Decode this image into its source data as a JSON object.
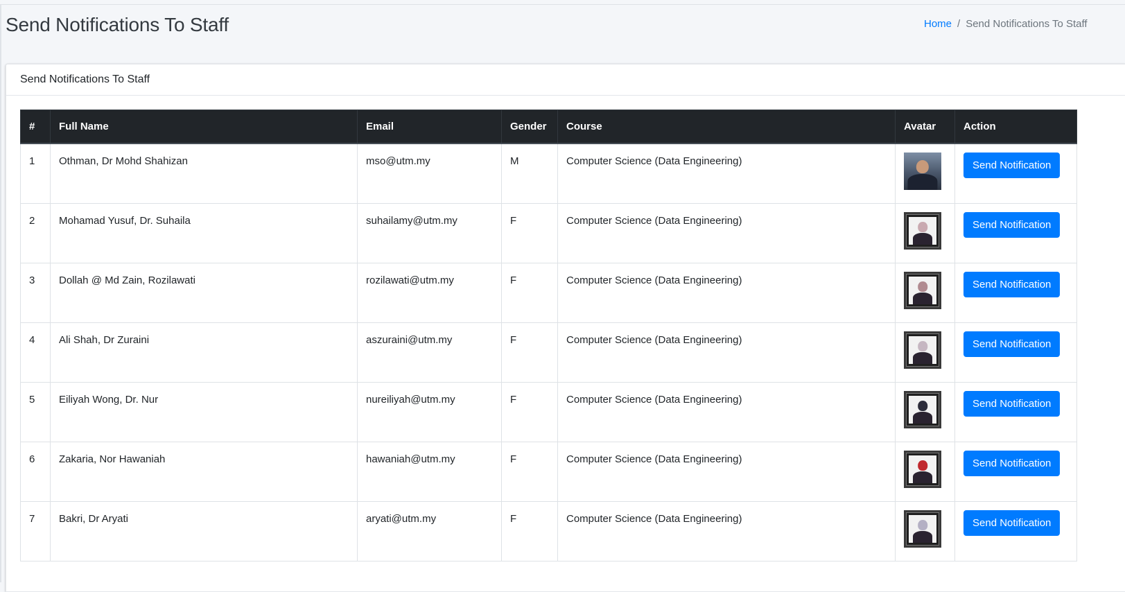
{
  "page": {
    "title": "Send Notifications To Staff"
  },
  "breadcrumb": {
    "home": "Home",
    "separator": "/",
    "current": "Send Notifications To Staff"
  },
  "card": {
    "header": "Send Notifications To Staff"
  },
  "table": {
    "columns": [
      "#",
      "Full Name",
      "Email",
      "Gender",
      "Course",
      "Avatar",
      "Action"
    ],
    "rows": [
      {
        "num": "1",
        "name": "Othman, Dr Mohd Shahizan",
        "email": "mso@utm.my",
        "gender": "M",
        "course": "Computer Science (Data Engineering)",
        "avatar": "photo-portrait",
        "action": "Send Notification"
      },
      {
        "num": "2",
        "name": "Mohamad Yusuf, Dr. Suhaila",
        "email": "suhailamy@utm.my",
        "gender": "F",
        "course": "Computer Science (Data Engineering)",
        "avatar": "framed-portrait",
        "action": "Send Notification"
      },
      {
        "num": "3",
        "name": "Dollah @ Md Zain, Rozilawati",
        "email": "rozilawati@utm.my",
        "gender": "F",
        "course": "Computer Science (Data Engineering)",
        "avatar": "framed-portrait",
        "action": "Send Notification"
      },
      {
        "num": "4",
        "name": "Ali Shah, Dr Zuraini",
        "email": "aszuraini@utm.my",
        "gender": "F",
        "course": "Computer Science (Data Engineering)",
        "avatar": "framed-portrait",
        "action": "Send Notification"
      },
      {
        "num": "5",
        "name": "Eiliyah Wong, Dr. Nur",
        "email": "nureiliyah@utm.my",
        "gender": "F",
        "course": "Computer Science (Data Engineering)",
        "avatar": "framed-portrait",
        "action": "Send Notification"
      },
      {
        "num": "6",
        "name": "Zakaria, Nor Hawaniah",
        "email": "hawaniah@utm.my",
        "gender": "F",
        "course": "Computer Science (Data Engineering)",
        "avatar": "framed-portrait",
        "action": "Send Notification"
      },
      {
        "num": "7",
        "name": "Bakri, Dr Aryati",
        "email": "aryati@utm.my",
        "gender": "F",
        "course": "Computer Science (Data Engineering)",
        "avatar": "framed-portrait",
        "action": "Send Notification"
      }
    ]
  },
  "colors": {
    "primary": "#007bff",
    "table_header_bg": "#212529",
    "page_bg": "#f4f6f9",
    "avatar_scarves": [
      "#e6e6e6",
      "#c9a9b0",
      "#b08a90",
      "#c6b7c2",
      "#2c2c3a",
      "#c0282d",
      "#b4b0c4"
    ]
  }
}
